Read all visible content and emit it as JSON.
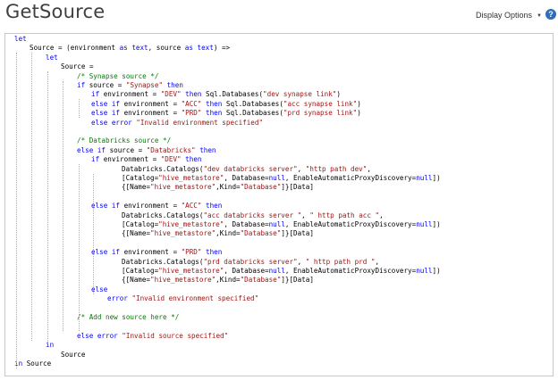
{
  "header": {
    "title": "GetSource",
    "display_options_label": "Display Options",
    "help_label": "?"
  },
  "editor": {
    "lines": [
      [
        [
          "kw",
          "let"
        ]
      ],
      [
        [
          "t",
          "Source = (environment "
        ],
        [
          "kw",
          "as"
        ],
        [
          "t",
          " "
        ],
        [
          "kw",
          "text"
        ],
        [
          "t",
          ", source "
        ],
        [
          "kw",
          "as"
        ],
        [
          "t",
          " "
        ],
        [
          "kw",
          "text"
        ],
        [
          "t",
          ") =>"
        ]
      ],
      [
        [
          "kw",
          "let"
        ]
      ],
      [
        [
          "t",
          "Source ="
        ]
      ],
      [
        [
          "cm",
          "/* Synapse source */"
        ]
      ],
      [
        [
          "kw",
          "if"
        ],
        [
          "t",
          " source = "
        ],
        [
          "str",
          "\"Synapse\""
        ],
        [
          "t",
          " "
        ],
        [
          "kw",
          "then"
        ]
      ],
      [
        [
          "kw",
          "if"
        ],
        [
          "t",
          " environment = "
        ],
        [
          "str",
          "\"DEV\""
        ],
        [
          "t",
          " "
        ],
        [
          "kw",
          "then"
        ],
        [
          "t",
          " Sql.Databases("
        ],
        [
          "str",
          "\"dev synapse link\""
        ],
        [
          "t",
          ")"
        ]
      ],
      [
        [
          "kw",
          "else if"
        ],
        [
          "t",
          " environment = "
        ],
        [
          "str",
          "\"ACC\""
        ],
        [
          "t",
          " "
        ],
        [
          "kw",
          "then"
        ],
        [
          "t",
          " Sql.Databases("
        ],
        [
          "str",
          "\"acc synapse link\""
        ],
        [
          "t",
          ")"
        ]
      ],
      [
        [
          "kw",
          "else if"
        ],
        [
          "t",
          " environment = "
        ],
        [
          "str",
          "\"PRD\""
        ],
        [
          "t",
          " "
        ],
        [
          "kw",
          "then"
        ],
        [
          "t",
          " Sql.Databases("
        ],
        [
          "str",
          "\"prd synapse link\""
        ],
        [
          "t",
          ")"
        ]
      ],
      [
        [
          "kw",
          "else error"
        ],
        [
          "t",
          " "
        ],
        [
          "str",
          "\"Invalid environment specified\""
        ]
      ],
      [],
      [
        [
          "cm",
          "/* Databricks source */"
        ]
      ],
      [
        [
          "kw",
          "else if"
        ],
        [
          "t",
          " source = "
        ],
        [
          "str",
          "\"Databricks\""
        ],
        [
          "t",
          " "
        ],
        [
          "kw",
          "then"
        ]
      ],
      [
        [
          "kw",
          "if"
        ],
        [
          "t",
          " environment = "
        ],
        [
          "str",
          "\"DEV\""
        ],
        [
          "t",
          " "
        ],
        [
          "kw",
          "then"
        ]
      ],
      [
        [
          "t",
          "Databricks.Catalogs("
        ],
        [
          "str",
          "\"dev databricks server\""
        ],
        [
          "t",
          ", "
        ],
        [
          "str",
          "\"http path dev\""
        ],
        [
          "t",
          ","
        ]
      ],
      [
        [
          "t",
          "[Catalog="
        ],
        [
          "str",
          "\"hive_metastore\""
        ],
        [
          "t",
          ", Database="
        ],
        [
          "kw",
          "null"
        ],
        [
          "t",
          ", EnableAutomaticProxyDiscovery="
        ],
        [
          "kw",
          "null"
        ],
        [
          "t",
          "])"
        ]
      ],
      [
        [
          "t",
          "{[Name="
        ],
        [
          "str",
          "\"hive_metastore\""
        ],
        [
          "t",
          ",Kind="
        ],
        [
          "str",
          "\"Database\""
        ],
        [
          "t",
          "]}[Data]"
        ]
      ],
      [],
      [
        [
          "kw",
          "else if"
        ],
        [
          "t",
          " environment = "
        ],
        [
          "str",
          "\"ACC\""
        ],
        [
          "t",
          " "
        ],
        [
          "kw",
          "then"
        ]
      ],
      [
        [
          "t",
          "Databricks.Catalogs("
        ],
        [
          "str",
          "\"acc databricks server \""
        ],
        [
          "t",
          ", "
        ],
        [
          "str",
          "\" http path acc \""
        ],
        [
          "t",
          ","
        ]
      ],
      [
        [
          "t",
          "[Catalog="
        ],
        [
          "str",
          "\"hive_metastore\""
        ],
        [
          "t",
          ", Database="
        ],
        [
          "kw",
          "null"
        ],
        [
          "t",
          ", EnableAutomaticProxyDiscovery="
        ],
        [
          "kw",
          "null"
        ],
        [
          "t",
          "])"
        ]
      ],
      [
        [
          "t",
          "{[Name="
        ],
        [
          "str",
          "\"hive_metastore\""
        ],
        [
          "t",
          ",Kind="
        ],
        [
          "str",
          "\"Database\""
        ],
        [
          "t",
          "]}[Data]"
        ]
      ],
      [],
      [
        [
          "kw",
          "else if"
        ],
        [
          "t",
          " environment = "
        ],
        [
          "str",
          "\"PRD\""
        ],
        [
          "t",
          " "
        ],
        [
          "kw",
          "then"
        ]
      ],
      [
        [
          "t",
          "Databricks.Catalogs("
        ],
        [
          "str",
          "\"prd databricks server\""
        ],
        [
          "t",
          ", "
        ],
        [
          "str",
          "\" http path prd \""
        ],
        [
          "t",
          ","
        ]
      ],
      [
        [
          "t",
          "[Catalog="
        ],
        [
          "str",
          "\"hive_metastore\""
        ],
        [
          "t",
          ", Database="
        ],
        [
          "kw",
          "null"
        ],
        [
          "t",
          ", EnableAutomaticProxyDiscovery="
        ],
        [
          "kw",
          "null"
        ],
        [
          "t",
          "])"
        ]
      ],
      [
        [
          "t",
          "{[Name="
        ],
        [
          "str",
          "\"hive_metastore\""
        ],
        [
          "t",
          ",Kind="
        ],
        [
          "str",
          "\"Database\""
        ],
        [
          "t",
          "]}[Data]"
        ]
      ],
      [
        [
          "kw",
          "else"
        ]
      ],
      [
        [
          "kw",
          "error"
        ],
        [
          "t",
          " "
        ],
        [
          "str",
          "\"Invalid environment specified\""
        ]
      ],
      [],
      [
        [
          "cm",
          "/* Add new source here */"
        ]
      ],
      [],
      [
        [
          "kw",
          "else error"
        ],
        [
          "t",
          " "
        ],
        [
          "str",
          "\"Invalid source specified\""
        ]
      ],
      [
        [
          "kw",
          "in"
        ]
      ],
      [
        [
          "t",
          "Source"
        ]
      ],
      [
        [
          "kw",
          "in"
        ],
        [
          "t",
          " Source"
        ]
      ]
    ]
  }
}
